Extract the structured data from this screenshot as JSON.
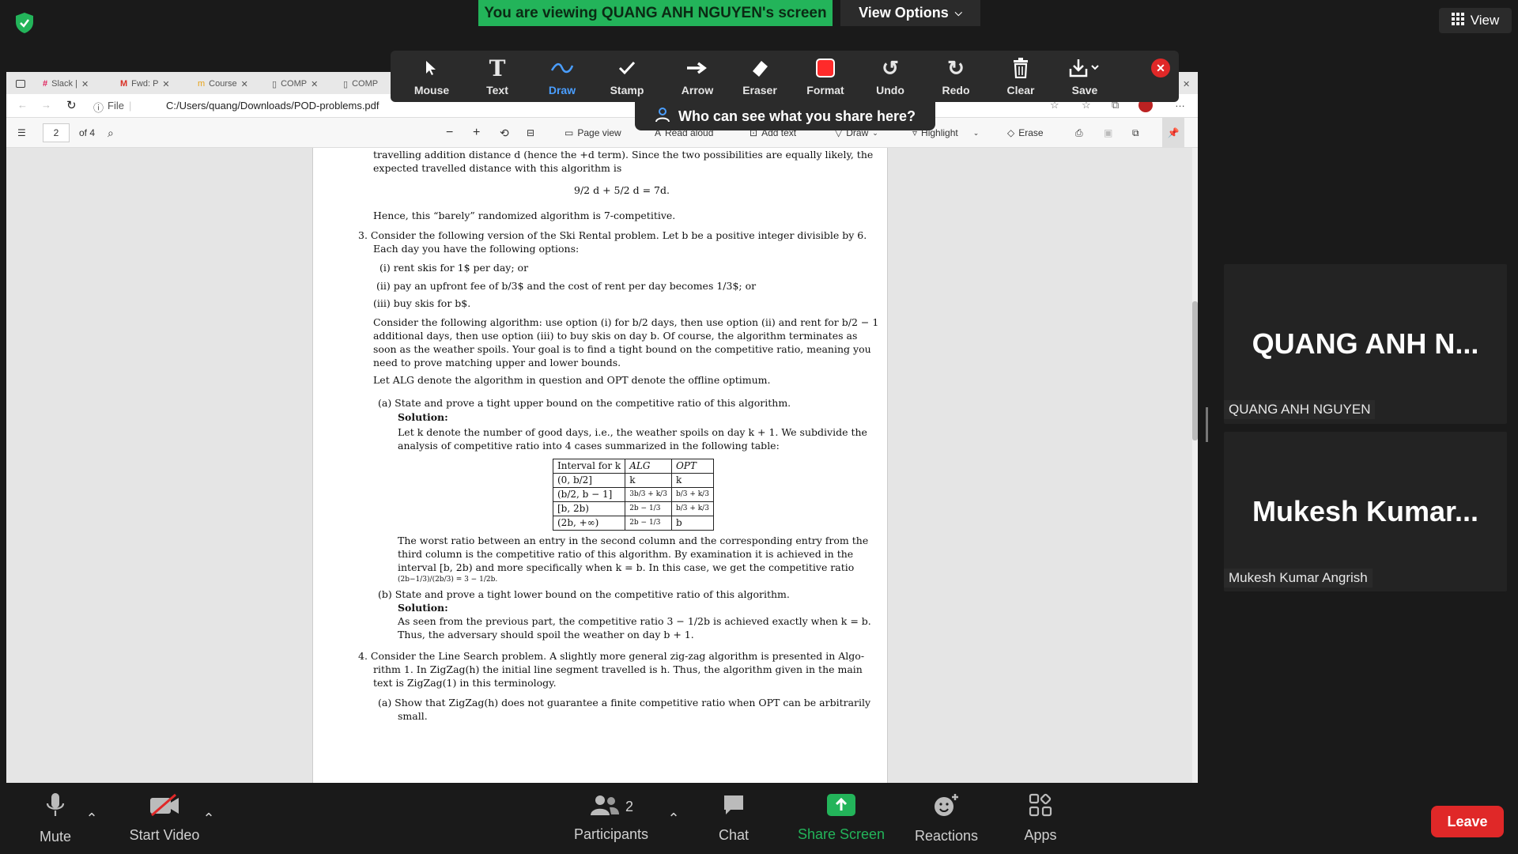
{
  "banner": {
    "text": "You are viewing QUANG ANH NGUYEN's screen",
    "view_options": "View Options"
  },
  "view_button": "View",
  "browser": {
    "tabs": [
      "Slack |",
      "Fwd: P",
      "Course",
      "COMP",
      "COMP"
    ],
    "file_label": "File",
    "url": "C:/Users/quang/Downloads/POD-problems.pdf"
  },
  "pdf_toolbar": {
    "page_input": "2",
    "page_total": "of 4",
    "page_view": "Page view",
    "read_aloud": "Read aloud",
    "add_text": "Add text",
    "draw": "Draw",
    "highlight": "Highlight",
    "erase": "Erase"
  },
  "annotation": {
    "tools": [
      "Mouse",
      "Text",
      "Draw",
      "Stamp",
      "Arrow",
      "Eraser",
      "Format",
      "Undo",
      "Redo",
      "Clear",
      "Save"
    ],
    "who_can_see": "Who can see what you share here?"
  },
  "document": {
    "l1": "travelling addition distance d (hence the +d term). Since the two possibilities are equally likely, the",
    "l2": "expected travelled distance with this algorithm is",
    "eq1": "9/2 d + 5/2 d = 7d.",
    "l3": "Hence, this “barely” randomized algorithm is 7-competitive.",
    "p3a": "3.  Consider the following version of the Ski Rental problem. Let b be a positive integer divisible by 6.",
    "p3b": "Each day you have the following options:",
    "opt1": "(i)  rent skis for 1$ per day; or",
    "opt2": "(ii)  pay an upfront fee of b/3$ and the cost of rent per day becomes 1/3$; or",
    "opt3": "(iii)  buy skis for b$.",
    "alg1": "Consider the following algorithm: use option (i) for b/2 days, then use option (ii) and rent for b/2 − 1",
    "alg2": "additional days, then use option (iii) to buy skis on day b. Of course, the algorithm terminates as",
    "alg3": "soon as the weather spoils. Your goal is to find a tight bound on the competitive ratio, meaning you",
    "alg4": "need to prove matching upper and lower bounds.",
    "alg5": "Let ALG denote the algorithm in question and OPT denote the offline optimum.",
    "qa": "(a)  State and prove a tight upper bound on the competitive ratio of this algorithm.",
    "solution": "Solution:",
    "sa1": "Let k denote the number of good days, i.e., the weather spoils on day k + 1. We subdivide the",
    "sa2": "analysis of competitive ratio into 4 cases summarized in the following table:",
    "table_header": [
      "Interval for k",
      "ALG",
      "OPT"
    ],
    "table_rows": [
      [
        "(0, b/2]",
        "k",
        "k"
      ],
      [
        "(b/2, b − 1]",
        "3b/3 + k/3",
        "b/3 + k/3"
      ],
      [
        "[b, 2b)",
        "2b − 1/3",
        "b/3 + k/3"
      ],
      [
        "(2b, +∞)",
        "2b − 1/3",
        "b"
      ]
    ],
    "w1": "The worst ratio between an entry in the second column and the corresponding entry from the",
    "w2": "third column is the competitive ratio of this algorithm. By examination it is achieved in the",
    "w3": "interval [b, 2b) and more specifically when k = b. In this case, we get the competitive ratio",
    "w4": "(2b−1/3)/(2b/3) = 3 − 1/2b.",
    "qb": "(b)  State and prove a tight lower bound on the competitive ratio of this algorithm.",
    "sb1": "As seen from the previous part, the competitive ratio 3 − 1/2b is achieved exactly when k = b.",
    "sb2": "Thus, the adversary should spoil the weather on day b + 1.",
    "p4a": "4.  Consider the Line Search problem. A slightly more general zig-zag algorithm is presented in Algo-",
    "p4b": "rithm 1. In ZigZag(h) the initial line segment travelled is h. Thus, the algorithm given in the main",
    "p4c": "text is ZigZag(1) in this terminology.",
    "q4a1": "(a)  Show that ZigZag(h) does not guarantee a finite competitive ratio when OPT can be arbitrarily",
    "q4a2": "small."
  },
  "participants_tiles": [
    {
      "big": "QUANG ANH N...",
      "label": "QUANG ANH NGUYEN"
    },
    {
      "big": "Mukesh Kumar...",
      "label": "Mukesh Kumar Angrish"
    }
  ],
  "bottom_bar": {
    "mute": "Mute",
    "start_video": "Start Video",
    "participants": "Participants",
    "participants_count": "2",
    "chat": "Chat",
    "share_screen": "Share Screen",
    "reactions": "Reactions",
    "apps": "Apps",
    "leave": "Leave"
  },
  "colors": {
    "banner": "#23b45a",
    "share": "#23b45a",
    "leave": "#e02828",
    "draw_active": "#4a9eff",
    "format_red": "#ff2a2a"
  }
}
